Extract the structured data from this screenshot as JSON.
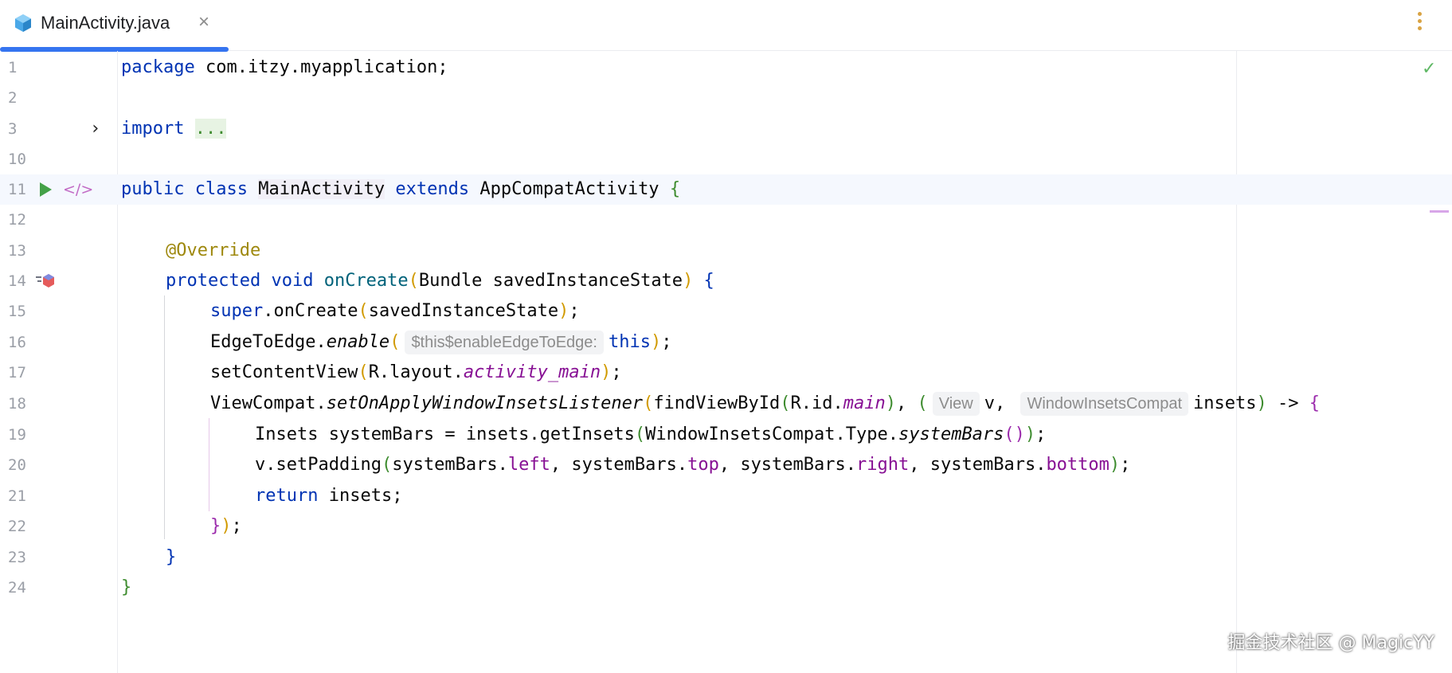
{
  "tab": {
    "title": "MainActivity.java",
    "close": "×"
  },
  "gutter": {
    "line_numbers": [
      "1",
      "2",
      "3",
      "10",
      "11",
      "12",
      "13",
      "14",
      "15",
      "16",
      "17",
      "18",
      "19",
      "20",
      "21",
      "22",
      "23",
      "24"
    ],
    "fold_chevron": "›",
    "implementation_icon": "</>"
  },
  "status": {
    "check": "✓"
  },
  "code": {
    "l1": {
      "kw": "package",
      "rest": " com.itzy.myapplication;"
    },
    "l3": {
      "kw": "import",
      "folded": "..."
    },
    "l11": {
      "kw1": "public",
      "kw2": "class",
      "cls": "MainActivity",
      "kw3": "extends",
      "sup": " AppCompatActivity ",
      "brace": "{"
    },
    "l13": {
      "ann": "@Override"
    },
    "l14": {
      "kw1": "protected",
      "kw2": "void",
      "meth": "onCreate",
      "p1": "(",
      "args": "Bundle savedInstanceState",
      "p2": ")",
      "brace": " {"
    },
    "l15": {
      "kw": "super",
      "call": ".onCreate",
      "p1": "(",
      "arg": "savedInstanceState",
      "p2": ")",
      "end": ";"
    },
    "l16": {
      "cls": "EdgeToEdge.",
      "meth": "enable",
      "p1": "(",
      "hint": "$this$enableEdgeToEdge:",
      "kw": "this",
      "p2": ")",
      "end": ";"
    },
    "l17": {
      "call": "setContentView",
      "p1": "(",
      "pre": "R.layout.",
      "field": "activity_main",
      "p2": ")",
      "end": ";"
    },
    "l18": {
      "cls": "ViewCompat.",
      "meth": "setOnApplyWindowInsetsListener",
      "p1": "(",
      "call": "findViewById",
      "p2": "(",
      "pre": "R.id.",
      "field": "main",
      "p3": ")",
      "comma": ", ",
      "p4": "(",
      "hint1": "View",
      "v": "v, ",
      "hint2": "WindowInsetsCompat",
      "insets": "insets",
      "p5": ")",
      "arrow": " -> ",
      "brace": "{"
    },
    "l19": {
      "pre": "Insets systemBars = insets.getInsets",
      "p1": "(",
      "mid": "WindowInsetsCompat.Type.",
      "meth": "systemBars",
      "p2": "()",
      "p3": ")",
      "end": ";"
    },
    "l20": {
      "pre": "v.setPadding",
      "p1": "(",
      "a": "systemBars.",
      "f1": "left",
      "b": ", systemBars.",
      "f2": "top",
      "c": ", systemBars.",
      "f3": "right",
      "d": ", systemBars.",
      "f4": "bottom",
      "p2": ")",
      "end": ";"
    },
    "l21": {
      "kw": "return",
      "rest": " insets;"
    },
    "l22": {
      "brace": "}",
      "p": ")",
      "end": ";"
    },
    "l23": {
      "brace": "}"
    },
    "l24": {
      "brace": "}"
    }
  },
  "watermark": "掘金技术社区 @ MagicYY"
}
